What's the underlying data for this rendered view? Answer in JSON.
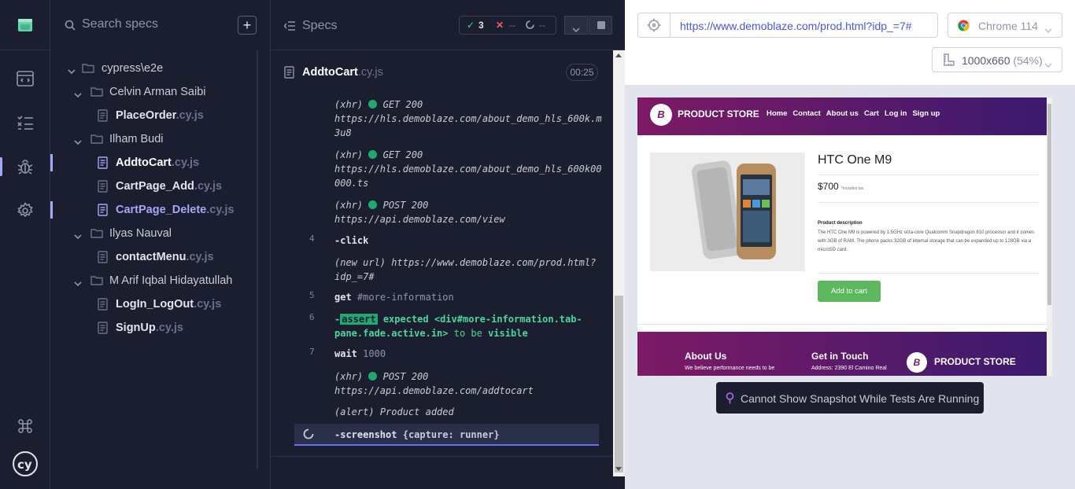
{
  "specs_panel": {
    "search_placeholder": "Search specs",
    "add_label": "+",
    "tree": [
      {
        "type": "folder",
        "label": "cypress\\e2e"
      },
      {
        "type": "folder",
        "label": "Celvin Arman Saibi"
      },
      {
        "type": "file",
        "name": "PlaceOrder",
        "ext": ".cy.js"
      },
      {
        "type": "folder",
        "label": "Ilham Budi"
      },
      {
        "type": "file",
        "name": "AddtoCart",
        "ext": ".cy.js"
      },
      {
        "type": "file",
        "name": "CartPage_Add",
        "ext": ".cy.js"
      },
      {
        "type": "file",
        "name": "CartPage_Delete",
        "ext": ".cy.js"
      },
      {
        "type": "folder",
        "label": "Ilyas Nauval"
      },
      {
        "type": "file",
        "name": "contactMenu",
        "ext": ".cy.js"
      },
      {
        "type": "folder",
        "label": "M Arif Iqbal Hidayatullah"
      },
      {
        "type": "file",
        "name": "LogIn_LogOut",
        "ext": ".cy.js"
      },
      {
        "type": "file",
        "name": "SignUp",
        "ext": ".cy.js"
      }
    ]
  },
  "reporter": {
    "title": "Specs",
    "stats": {
      "passed": "3",
      "failed": "--",
      "pending": "--"
    },
    "spec_name": "AddtoCart",
    "spec_ext": ".cy.js",
    "timer": "00:25",
    "log": {
      "xhr": "(xhr)",
      "get200": "GET 200",
      "post200": "POST 200",
      "url1a": "https://hls.demoblaze.com/about_demo_hls_600k.m",
      "url1b": "3u8",
      "url2a": "https://hls.demoblaze.com/about_demo_hls_600k00",
      "url2b": "000.ts",
      "url3": "https://api.demoblaze.com/view",
      "n4": "4",
      "click": "-click",
      "newurl": "(new url)",
      "newurl_a": "https://www.demoblaze.com/prod.html?",
      "newurl_b": "idp_=7#",
      "n5": "5",
      "get": "get",
      "get_sel": "#more-information",
      "n6": "6",
      "dash": "-",
      "assert": "assert",
      "expected": "expected",
      "assert_sel_a": "<div#more-information.tab-",
      "assert_sel_b": "pane.fade.active.in>",
      "to_be": "to be",
      "visible": "visible",
      "n7": "7",
      "wait": "wait",
      "wait_val": "1000",
      "url4": "https://api.demoblaze.com/addtocart",
      "alert": "(alert)",
      "alert_msg": "Product added",
      "screenshot": "-screenshot",
      "screenshot_arg": "{capture: runner}"
    }
  },
  "browser": {
    "url": "https://www.demoblaze.com/prod.html?idp_=7#",
    "name": "Chrome 114",
    "viewport": "1000x660",
    "scale": "(54%)"
  },
  "snapshot": {
    "brand": "PRODUCT STORE",
    "logo_letter": "B",
    "nav": [
      "Home",
      "Contact",
      "About us",
      "Cart",
      "Log in",
      "Sign up"
    ],
    "product_name": "HTC One M9",
    "price": "$700",
    "price_note": "*includes tax",
    "desc_heading": "Product description",
    "desc": "The HTC One M9 is powered by 1.5GHz octa-core Qualcomm Snapdragon 810 processor and it comes with 3GB of RAM. The phone packs 32GB of internal storage that can be expanded up to 128GB via a microSD card.",
    "add_to_cart": "Add to cart",
    "footer_about": "About Us",
    "footer_about_sub": "We believe performance needs to be",
    "footer_touch": "Get in Touch",
    "footer_touch_sub": "Address: 2390 El Camino Real",
    "footer_brand": "PRODUCT STORE"
  },
  "toast": "Cannot Show Snapshot While Tests Are Running",
  "colors": {
    "accent": "#a3a9f6",
    "pass": "#1fa971",
    "brand_gradient_start": "#7d1a65",
    "brand_gradient_end": "#3a1a6e"
  }
}
